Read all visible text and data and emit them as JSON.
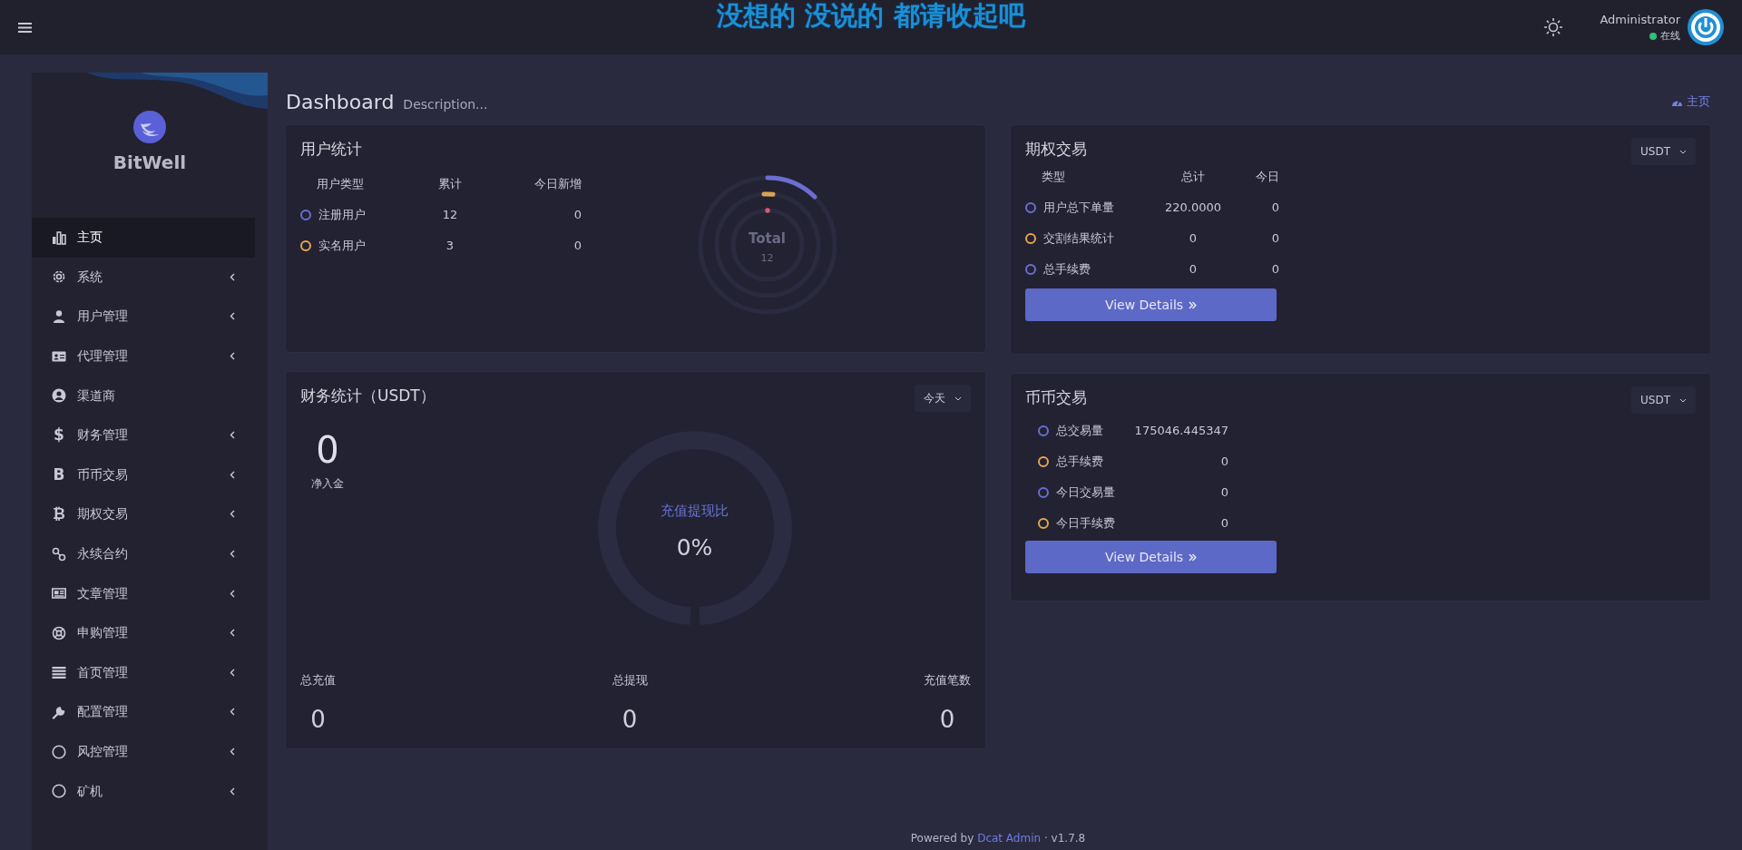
{
  "header": {
    "banner": "没想的 没说的 都请收起吧",
    "user_name": "Administrator",
    "user_status": "在线"
  },
  "sidebar": {
    "brand": "BitWell",
    "items": [
      {
        "label": "主页",
        "selected": true,
        "expandable": false
      },
      {
        "label": "系统",
        "selected": false,
        "expandable": true
      },
      {
        "label": "用户管理",
        "selected": false,
        "expandable": true
      },
      {
        "label": "代理管理",
        "selected": false,
        "expandable": true
      },
      {
        "label": "渠道商",
        "selected": false,
        "expandable": false
      },
      {
        "label": "财务管理",
        "selected": false,
        "expandable": true,
        "glyph": "$"
      },
      {
        "label": "币币交易",
        "selected": false,
        "expandable": true,
        "glyph": "B"
      },
      {
        "label": "期权交易",
        "selected": false,
        "expandable": true,
        "glyph": "₿"
      },
      {
        "label": "永续合约",
        "selected": false,
        "expandable": true
      },
      {
        "label": "文章管理",
        "selected": false,
        "expandable": true
      },
      {
        "label": "申购管理",
        "selected": false,
        "expandable": true
      },
      {
        "label": "首页管理",
        "selected": false,
        "expandable": true
      },
      {
        "label": "配置管理",
        "selected": false,
        "expandable": true
      },
      {
        "label": "风控管理",
        "selected": false,
        "expandable": true
      },
      {
        "label": "矿机",
        "selected": false,
        "expandable": true
      }
    ]
  },
  "page": {
    "title": "Dashboard",
    "description": "Description...",
    "breadcrumb": "主页"
  },
  "user_stats": {
    "title": "用户统计",
    "columns": [
      "用户类型",
      "累计",
      "今日新增"
    ],
    "rows": [
      {
        "label": "注册用户",
        "total": "12",
        "today": "0",
        "color": "#6b6fd1"
      },
      {
        "label": "实名用户",
        "total": "3",
        "today": "0",
        "color": "#e8a54b"
      }
    ],
    "chart": {
      "center_label": "Total",
      "center_value": "12"
    }
  },
  "options": {
    "title": "期权交易",
    "currency": "USDT",
    "columns": [
      "类型",
      "总计",
      "今日"
    ],
    "rows": [
      {
        "label": "用户总下单量",
        "total": "220.0000",
        "today": "0",
        "color": "#6b6fd1"
      },
      {
        "label": "交割结果统计",
        "total": "0",
        "today": "0",
        "color": "#e8a54b"
      },
      {
        "label": "总手续费",
        "total": "0",
        "today": "0",
        "color": "#6b6fd1"
      }
    ],
    "button": "View Details"
  },
  "finance": {
    "title": "财务统计（USDT）",
    "period": "今天",
    "net_value": "0",
    "net_label": "净入金",
    "ratio_label": "充值提现比",
    "ratio_value": "0%",
    "stats": [
      {
        "label": "总充值",
        "value": "0"
      },
      {
        "label": "总提现",
        "value": "0"
      },
      {
        "label": "充值笔数",
        "value": "0"
      }
    ]
  },
  "spot": {
    "title": "币币交易",
    "currency": "USDT",
    "rows": [
      {
        "label": "总交易量",
        "value": "175046.445347",
        "color": "#6b6fd1"
      },
      {
        "label": "总手续费",
        "value": "0",
        "color": "#e8a54b"
      },
      {
        "label": "今日交易量",
        "value": "0",
        "color": "#6b6fd1"
      },
      {
        "label": "今日手续费",
        "value": "0",
        "color": "#e8a54b"
      }
    ],
    "button": "View Details"
  },
  "footer": {
    "prefix": "Powered by",
    "link": "Dcat Admin",
    "suffix": "· v1.7.8"
  }
}
